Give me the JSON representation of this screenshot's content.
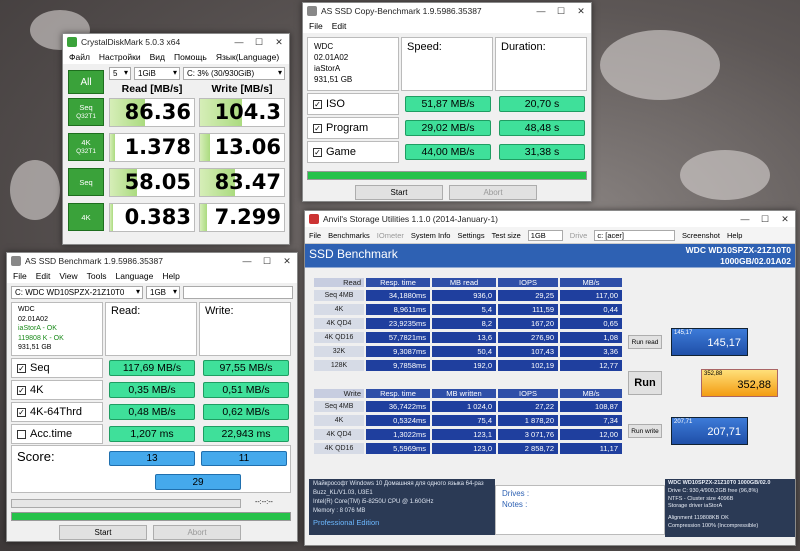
{
  "cdm": {
    "title": "CrystalDiskMark 5.0.3 x64",
    "menu": [
      "Файл",
      "Настройки",
      "Вид",
      "Помощь",
      "Язык(Language)"
    ],
    "all_label": "All",
    "count": "5",
    "size": "1GiB",
    "drive": "C: 3% (30/930GiB)",
    "read_header": "Read [MB/s]",
    "write_header": "Write [MB/s]",
    "rows": [
      {
        "l1": "Seq",
        "l2": "Q32T1",
        "read": "86.36",
        "write": "104.3",
        "rf": 0.42,
        "wf": 0.5
      },
      {
        "l1": "4K",
        "l2": "Q32T1",
        "read": "1.378",
        "write": "13.06",
        "rf": 0.06,
        "wf": 0.12
      },
      {
        "l1": "Seq",
        "l2": "",
        "read": "58.05",
        "write": "83.47",
        "rf": 0.32,
        "wf": 0.42
      },
      {
        "l1": "4K",
        "l2": "",
        "read": "0.383",
        "write": "7.299",
        "rf": 0.02,
        "wf": 0.08
      }
    ]
  },
  "copy": {
    "title": "AS SSD Copy-Benchmark 1.9.5986.35387",
    "menu": [
      "File",
      "Edit"
    ],
    "dev": [
      "WDC",
      "02.01A02",
      "iaStorA",
      "931,51 GB"
    ],
    "speed_header": "Speed:",
    "duration_header": "Duration:",
    "rows": [
      {
        "name": "ISO",
        "speed": "51,87 MB/s",
        "dur": "20,70 s"
      },
      {
        "name": "Program",
        "speed": "29,02 MB/s",
        "dur": "48,48 s"
      },
      {
        "name": "Game",
        "speed": "44,00 MB/s",
        "dur": "31,38 s"
      }
    ],
    "start": "Start",
    "abort": "Abort"
  },
  "asssd": {
    "title": "AS SSD Benchmark 1.9.5986.35387",
    "menu": [
      "File",
      "Edit",
      "View",
      "Tools",
      "Language",
      "Help"
    ],
    "drive": "C: WDC WD10SPZX-21Z10T0",
    "size": "1GB",
    "dev": {
      "model": "WDC",
      "fw": "02.01A02",
      "drv": "iaStorA - OK",
      "align": "119808 K - OK",
      "cap": "931,51 GB"
    },
    "read_header": "Read:",
    "write_header": "Write:",
    "rows": [
      {
        "name": "Seq",
        "read": "117,69 MB/s",
        "write": "97,55 MB/s",
        "checked": true
      },
      {
        "name": "4K",
        "read": "0,35 MB/s",
        "write": "0,51 MB/s",
        "checked": true
      },
      {
        "name": "4K-64Thrd",
        "read": "0,48 MB/s",
        "write": "0,62 MB/s",
        "checked": true
      },
      {
        "name": "Acc.time",
        "read": "1,207 ms",
        "write": "22,943 ms",
        "checked": false
      }
    ],
    "score_label": "Score:",
    "score_read": "13",
    "score_write": "11",
    "score_total": "29",
    "progress_text": "--:--:--",
    "start": "Start",
    "abort": "Abort"
  },
  "anvil": {
    "title": "Anvil's Storage Utilities 1.1.0 (2014-January-1)",
    "menu": [
      "File",
      "Benchmarks",
      "IOmeter",
      "System Info",
      "Settings",
      "Test size",
      "1GB",
      "Drive",
      "c: [acer]",
      "Screenshot",
      "Help"
    ],
    "heading": "SSD Benchmark",
    "model": "WDC WD10SPZX-21Z10T0",
    "model2": "1000GB/02.01A02",
    "read_headers": [
      "Read",
      "Resp. time",
      "MB read",
      "IOPS",
      "MB/s"
    ],
    "read_rows": [
      [
        "Seq 4MB",
        "34,1880ms",
        "936,0",
        "29,25",
        "117,00"
      ],
      [
        "4K",
        "8,9611ms",
        "5,4",
        "111,59",
        "0,44"
      ],
      [
        "4K QD4",
        "23,9235ms",
        "8,2",
        "167,20",
        "0,65"
      ],
      [
        "4K QD16",
        "57,7821ms",
        "13,6",
        "276,90",
        "1,08"
      ],
      [
        "32K",
        "9,3087ms",
        "50,4",
        "107,43",
        "3,36"
      ],
      [
        "128K",
        "9,7858ms",
        "192,0",
        "102,19",
        "12,77"
      ]
    ],
    "write_headers": [
      "Write",
      "Resp. time",
      "MB written",
      "IOPS",
      "MB/s"
    ],
    "write_rows": [
      [
        "Seq 4MB",
        "36,7422ms",
        "1 024,0",
        "27,22",
        "108,87"
      ],
      [
        "4K",
        "0,5324ms",
        "75,4",
        "1 878,20",
        "7,34"
      ],
      [
        "4K QD4",
        "1,3022ms",
        "123,1",
        "3 071,76",
        "12,00"
      ],
      [
        "4K QD16",
        "5,5969ms",
        "123,0",
        "2 858,72",
        "11,17"
      ]
    ],
    "run_read": "Run read",
    "run_write": "Run write",
    "run": "Run",
    "read_score": "145,17",
    "total_score": "352,88",
    "write_score": "207,71",
    "sys": [
      "Майкрософт Windows 10 Домашняя для одного языка 64-раз",
      "Buzz_KL/V1.03, U3E1",
      "Intel(R) Core(TM) i5-8250U CPU @ 1.60GHz",
      "Memory : 8 076 MB"
    ],
    "edition": "Professional Edition",
    "drives_label": "Drives :",
    "notes_label": "Notes :",
    "info": [
      "WDC WD10SPZX-21Z10T0 1000GB/02.0",
      "Drive C: 930,4/900,2GB free (96,8%)",
      "NTFS - Cluster size 4096B",
      "Storage driver  iaStorA",
      "",
      "Alignment 119808KB OK",
      "Compression 100% (Incompressible)"
    ]
  }
}
